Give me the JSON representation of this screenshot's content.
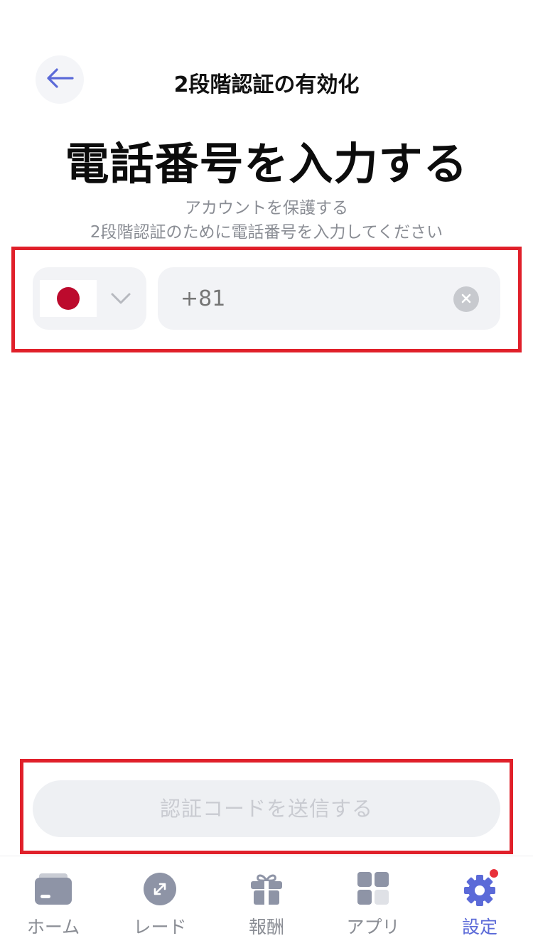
{
  "header": {
    "title": "2段階認証の有効化",
    "back_icon": "arrow-left-icon"
  },
  "main": {
    "title": "電話番号を入力する",
    "subtitle_line1": "アカウントを保護する",
    "subtitle_line2": "2段階認証のために電話番号を入力してください"
  },
  "phone": {
    "country_flag": "japan-flag-icon",
    "dial_code_placeholder": "+81",
    "value": ""
  },
  "actions": {
    "send_code_label": "認証コードを送信する"
  },
  "tabbar": {
    "items": [
      {
        "label": "ホーム",
        "icon": "wallet-icon"
      },
      {
        "label": "レード",
        "icon": "trade-icon"
      },
      {
        "label": "報酬",
        "icon": "gift-icon"
      },
      {
        "label": "アプリ",
        "icon": "apps-grid-icon"
      },
      {
        "label": "設定",
        "icon": "gear-icon",
        "active": true
      }
    ]
  },
  "colors": {
    "accent": "#5b6ad8",
    "highlight": "#e0202a",
    "disabled_button_bg": "#eef0f3",
    "disabled_button_text": "#c9cbd1",
    "badge": "#e8313a"
  }
}
